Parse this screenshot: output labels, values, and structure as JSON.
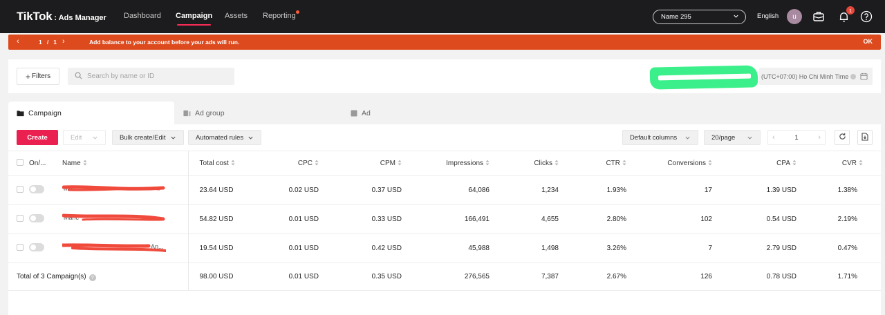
{
  "nav": {
    "brand": "TikTok",
    "product": ": Ads Manager",
    "items": [
      {
        "label": "Dashboard"
      },
      {
        "label": "Campaign"
      },
      {
        "label": "Assets"
      },
      {
        "label": "Reporting"
      }
    ],
    "account": "Name 295",
    "language": "English",
    "avatar_initial": "u",
    "notification_count": "1"
  },
  "banner": {
    "page_current": "1",
    "page_separator": "/",
    "page_total": "1",
    "message": "Add balance to your account before your ads will run.",
    "ok_label": "OK"
  },
  "filters": {
    "filters_label": "Filters",
    "search_placeholder": "Search by name or ID",
    "timezone": "(UTC+07:00) Ho Chi Minh Time"
  },
  "tabs": [
    {
      "label": "Campaign"
    },
    {
      "label": "Ad group"
    },
    {
      "label": "Ad"
    }
  ],
  "toolbar": {
    "create": "Create",
    "edit": "Edit",
    "bulk": "Bulk create/Edit",
    "rules": "Automated rules",
    "columns": "Default columns",
    "per_page": "20/page",
    "page": "1"
  },
  "table": {
    "headers": {
      "onoff": "On/...",
      "name": "Name",
      "total_cost": "Total cost",
      "cpc": "CPC",
      "cpm": "CPM",
      "impressions": "Impressions",
      "clicks": "Clicks",
      "ctr": "CTR",
      "conversions": "Conversions",
      "cpa": "CPA",
      "cvr": "CVR"
    },
    "rows": [
      {
        "name": "Mun",
        "total_cost": "23.64 USD",
        "cpc": "0.02 USD",
        "cpm": "0.37 USD",
        "impressions": "64,086",
        "clicks": "1,234",
        "ctr": "1.93%",
        "conversions": "17",
        "cpa": "1.39 USD",
        "cvr": "1.38%"
      },
      {
        "name": "Manc",
        "total_cost": "54.82 USD",
        "cpc": "0.01 USD",
        "cpm": "0.33 USD",
        "impressions": "166,491",
        "clicks": "4,655",
        "ctr": "2.80%",
        "conversions": "102",
        "cpa": "0.54 USD",
        "cvr": "2.19%"
      },
      {
        "name": "An...",
        "total_cost": "19.54 USD",
        "cpc": "0.01 USD",
        "cpm": "0.42 USD",
        "impressions": "45,988",
        "clicks": "1,498",
        "ctr": "3.26%",
        "conversions": "7",
        "cpa": "2.79 USD",
        "cvr": "0.47%"
      }
    ],
    "total": {
      "label": "Total of 3 Campaign(s)",
      "total_cost": "98.00 USD",
      "cpc": "0.01 USD",
      "cpm": "0.35 USD",
      "impressions": "276,565",
      "clicks": "7,387",
      "ctr": "2.67%",
      "conversions": "126",
      "cpa": "0.78 USD",
      "cvr": "1.71%"
    }
  },
  "colors": {
    "accent": "#fe2c55",
    "banner": "#dd4a1d",
    "create_button": "#ea2050",
    "redaction_mark": "#f04a3c",
    "date_redaction": "#3bf08a"
  }
}
